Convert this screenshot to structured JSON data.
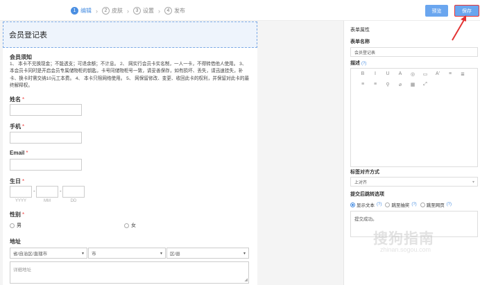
{
  "steps": [
    {
      "num": "1",
      "label": "编辑",
      "active": true
    },
    {
      "num": "2",
      "label": "皮肤"
    },
    {
      "num": "3",
      "label": "设置"
    },
    {
      "num": "4",
      "label": "发布"
    }
  ],
  "toolbar": {
    "preview_label": "预览",
    "save_label": "保存"
  },
  "form": {
    "title": "会员登记表",
    "notice_title": "会员须知",
    "notice_text": "1、 本卡不兑换现金；不能透支；可退余额；不计息。 2、 网实行会员卡实名制，一人一卡，不得转借他人使用。 3、 本会员卡同时是开启会员专属储物柜的钥匙，卡号同储物柜号一致，请妥善保存，如有损坏、丢失，请迅速挂失，补卡、换卡时需交纳10元工本费。 4、 本卡只限网络使用。 5、 网保留修改、变更、收回此卡的权利，并保留对此卡的最终解释权。",
    "required_mark": "*",
    "name_label": "姓名",
    "phone_label": "手机",
    "email_label": "Email",
    "birthday_label": "生日",
    "date_dash": "-",
    "date_placeholders": {
      "year": "YYYY",
      "month": "MM",
      "day": "DD"
    },
    "gender_label": "性别",
    "gender_options": {
      "male": "男",
      "female": "女"
    },
    "address_label": "地址",
    "province_placeholder": "省/自治区/直辖市",
    "city_placeholder": "市",
    "district_placeholder": "区/县",
    "detail_placeholder": "详细地址"
  },
  "panel": {
    "title": "表单属性",
    "name_label": "表单名称",
    "name_value": "会员登记表",
    "desc_label": "描述",
    "help_mark": "(?)",
    "align_label": "标签对齐方式",
    "align_value": "上对齐",
    "redirect_label": "提交后跳转选项",
    "redirect_options": {
      "text": "显示文本",
      "lottery": "跳至抽奖",
      "page": "跳至网页"
    },
    "success_text": "提交成功。"
  },
  "icons": {
    "caret": "▾",
    "resize": "◢",
    "editor_row1": [
      "B",
      "I",
      "U",
      "A",
      "◎",
      "▭",
      "A'",
      "≡",
      "≣"
    ],
    "editor_row2": [
      "≡",
      "≡",
      "⚲",
      "⌀",
      "▦",
      "⤢"
    ]
  },
  "watermark": {
    "main": "搜狗指南",
    "sub": "zhinan.sogou.com"
  },
  "colors": {
    "accent": "#4a8fe2",
    "button": "#6aa6ef",
    "annotation": "#e33333"
  }
}
